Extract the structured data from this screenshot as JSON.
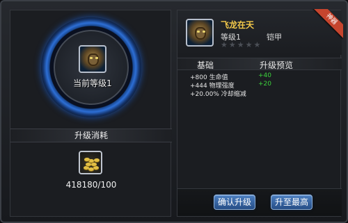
{
  "left": {
    "current_level_label": "当前等级1",
    "section_title": "升级消耗",
    "cost_amount": "418180/100"
  },
  "item": {
    "name": "飞龙在天",
    "level": "等级1",
    "type": "铠甲",
    "stars": "★★★★★",
    "stars_filled": 0,
    "stars_total": 5,
    "ribbon": "神器"
  },
  "table": {
    "col_base": "基础",
    "col_preview": "升级预览",
    "rows": [
      {
        "base": "+800 生命值",
        "up": "+40"
      },
      {
        "base": "+444 物理强度",
        "up": "+20"
      },
      {
        "base": "+20.00% 冷却缩减",
        "up": ""
      }
    ]
  },
  "buttons": {
    "confirm": "确认升级",
    "max": "升至最高"
  },
  "colors": {
    "item_name": "#f3c94a",
    "upgrade_green": "#3cd23c",
    "ring_blue": "#2d6fd6",
    "button_blue": "#264d86",
    "ribbon_red": "#c5452e"
  }
}
